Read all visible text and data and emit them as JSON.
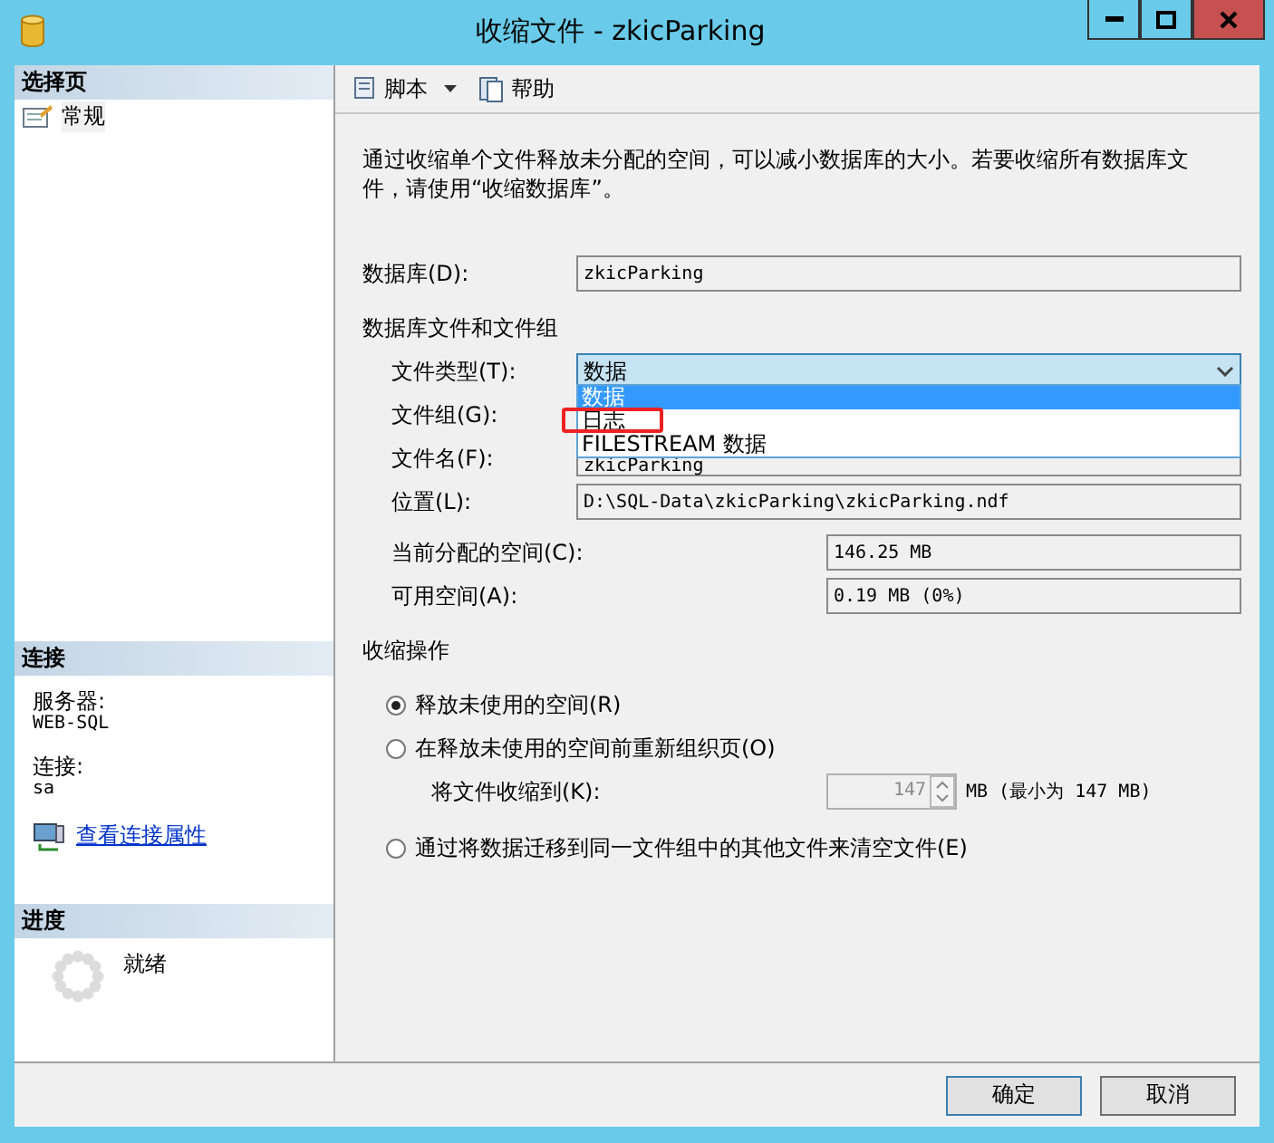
{
  "window": {
    "title": "收缩文件 - zkicParking"
  },
  "sidebar": {
    "select_page": {
      "heading": "选择页",
      "items": [
        {
          "label": "常规",
          "selected": true
        }
      ]
    },
    "connection": {
      "heading": "连接",
      "server_label": "服务器:",
      "server": "WEB-SQL",
      "connection_label": "连接:",
      "connection": "sa",
      "link": "查看连接属性"
    },
    "progress": {
      "heading": "进度",
      "status": "就绪"
    }
  },
  "toolbar": [
    {
      "label": "脚本",
      "kind": "dropdown"
    },
    {
      "label": "帮助",
      "kind": "button"
    }
  ],
  "description": "通过收缩单个文件释放未分配的空间，可以减小数据库的大小。若要收缩所有数据库文件，请使用“收缩数据库”。",
  "database": {
    "label": "数据库(D):",
    "value": "zkicParking"
  },
  "files_section": {
    "heading": "数据库文件和文件组",
    "file_type": {
      "label": "文件类型(T):",
      "value": "数据",
      "expanded": true,
      "options": [
        {
          "label": "数据",
          "selected": true,
          "marked": false
        },
        {
          "label": "日志",
          "selected": false,
          "marked": true
        },
        {
          "label": "FILESTREAM 数据",
          "selected": false,
          "marked": false
        }
      ]
    },
    "file_group": {
      "label": "文件组(G):"
    },
    "file_name": {
      "label": "文件名(F):",
      "value": "zkicParking"
    },
    "location": {
      "label": "位置(L):",
      "value": "D:\\SQL-Data\\zkicParking\\zkicParking.ndf"
    },
    "allocated": {
      "label": "当前分配的空间(C):",
      "value": "146.25 MB"
    },
    "free": {
      "label": "可用空间(A):",
      "value": "0.19 MB (0%)"
    }
  },
  "shrink_section": {
    "heading": "收缩操作",
    "options": [
      {
        "label": "释放未使用的空间(R)",
        "selected": true
      },
      {
        "label": "在释放未使用的空间前重新组织页(O)",
        "selected": false,
        "shrink_to": {
          "label": "将文件收缩到(K):",
          "value": "147",
          "unit": "MB (最小为 147 MB)",
          "disabled": true
        }
      },
      {
        "label": "通过将数据迁移到同一文件组中的其他文件来清空文件(E)",
        "selected": false
      }
    ]
  },
  "buttons": [
    {
      "label": "确定",
      "default": true
    },
    {
      "label": "取消",
      "default": false
    }
  ]
}
